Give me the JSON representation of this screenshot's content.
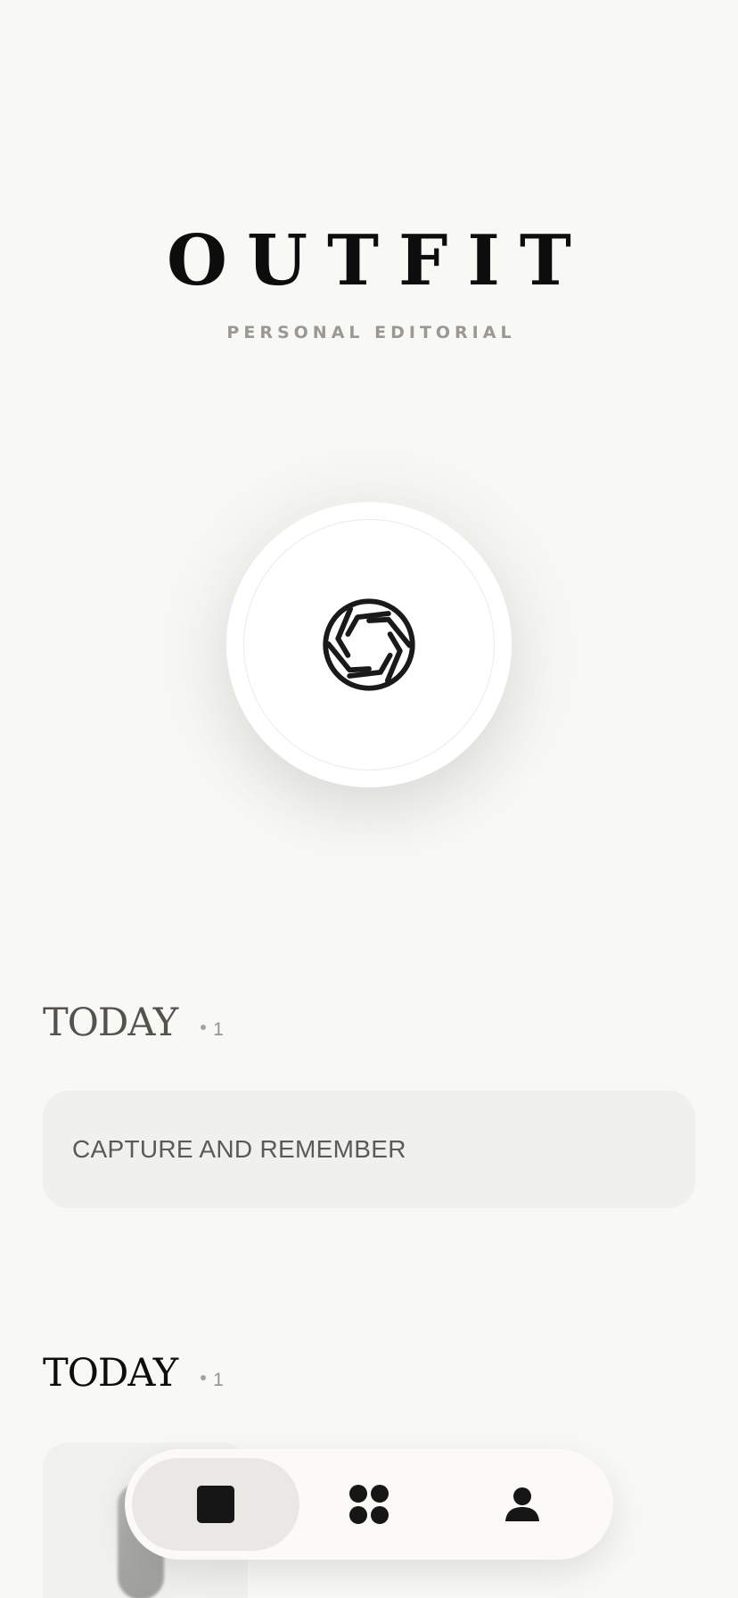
{
  "brand": {
    "title": "OUTFIT",
    "subtitle": "PERSONAL EDITORIAL"
  },
  "capture": {
    "icon": "aperture-icon"
  },
  "sections": [
    {
      "title": "TODAY",
      "count": "1",
      "color": "#55524e",
      "items": [
        {
          "type": "note",
          "text": "CAPTURE AND REMEMBER"
        }
      ]
    },
    {
      "title": "TODAY",
      "count": "1",
      "color": "#0d0d0d",
      "items": [
        {
          "type": "photo"
        }
      ]
    }
  ],
  "nav": {
    "items": [
      {
        "name": "capture",
        "icon": "square-icon",
        "active": true
      },
      {
        "name": "collection",
        "icon": "four-dots-icon",
        "active": false
      },
      {
        "name": "profile",
        "icon": "person-icon",
        "active": false
      }
    ]
  },
  "colors": {
    "background": "#f8f8f5",
    "card": "#f0f0ec",
    "ink": "#161616",
    "muted": "#9b9893"
  }
}
